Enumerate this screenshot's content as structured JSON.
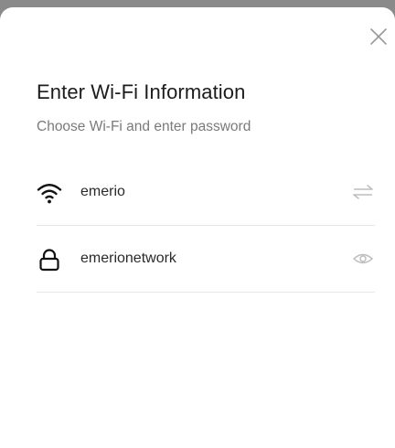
{
  "dialog": {
    "title": "Enter Wi-Fi Information",
    "subtitle": "Choose Wi-Fi and enter password",
    "close_icon": "close-icon"
  },
  "wifi": {
    "ssid": "emerio",
    "icon": "wifi-icon",
    "action_icon": "swap-icon"
  },
  "password": {
    "value": "emerionetwork",
    "icon": "lock-icon",
    "action_icon": "eye-icon"
  },
  "colors": {
    "title": "#1c1c1c",
    "subtitle": "#7a7a7a",
    "divider": "#e6e6e6",
    "muted_icon": "#bdbdbd"
  }
}
